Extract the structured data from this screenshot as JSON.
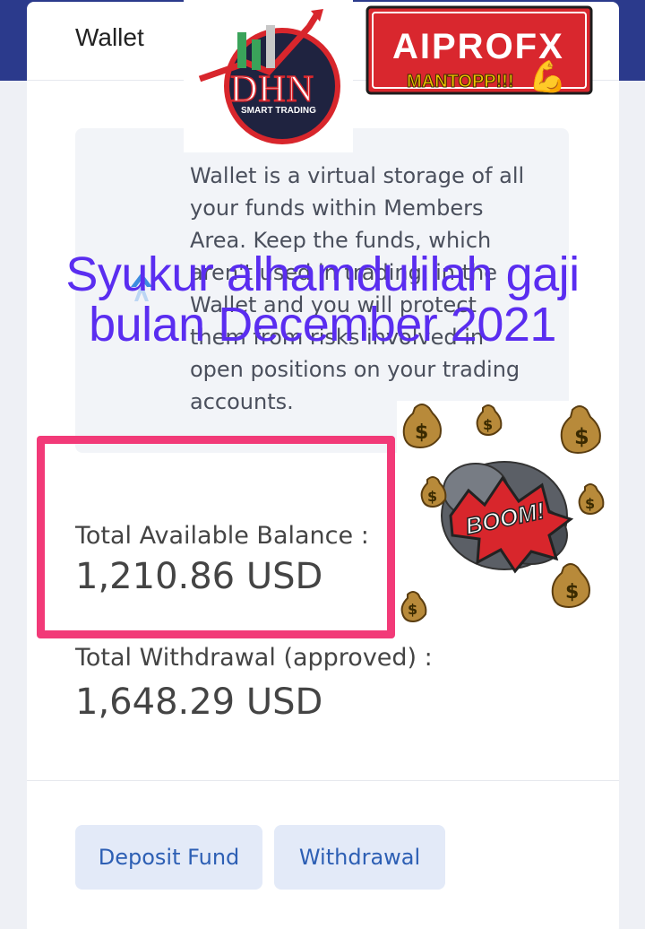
{
  "wallet": {
    "title": "Wallet",
    "description": "Wallet is a virtual storage of all your funds within Members Area. Keep the funds, which aren't used in trading, in the Wallet and you will protect them from risks involved in open positions on your trading accounts.",
    "balance_label": "Total Available Balance :",
    "balance_value": "1,210.86 USD",
    "withdrawal_label": "Total Withdrawal (approved) :",
    "withdrawal_value": "1,648.29 USD"
  },
  "actions": {
    "deposit_label": "Deposit Fund",
    "withdrawal_label": "Withdrawal"
  },
  "overlay": {
    "caption_line1": "Syukur alhamdulilah gaji",
    "caption_line2": "bulan December 2021",
    "dhn_logo_text": "DHN",
    "dhn_logo_subtext": "SMART TRADING",
    "aiprofx_logo_text": "AIPROFX",
    "aiprofx_tagline": "MANTOPP!!!",
    "boom_text": "BOOM!"
  },
  "colors": {
    "header_band": "#2b3a8c",
    "button_text": "#2d5fb4",
    "button_bg": "#e3eaf8",
    "caption": "#5a2df0",
    "highlight": "#f23a78"
  }
}
